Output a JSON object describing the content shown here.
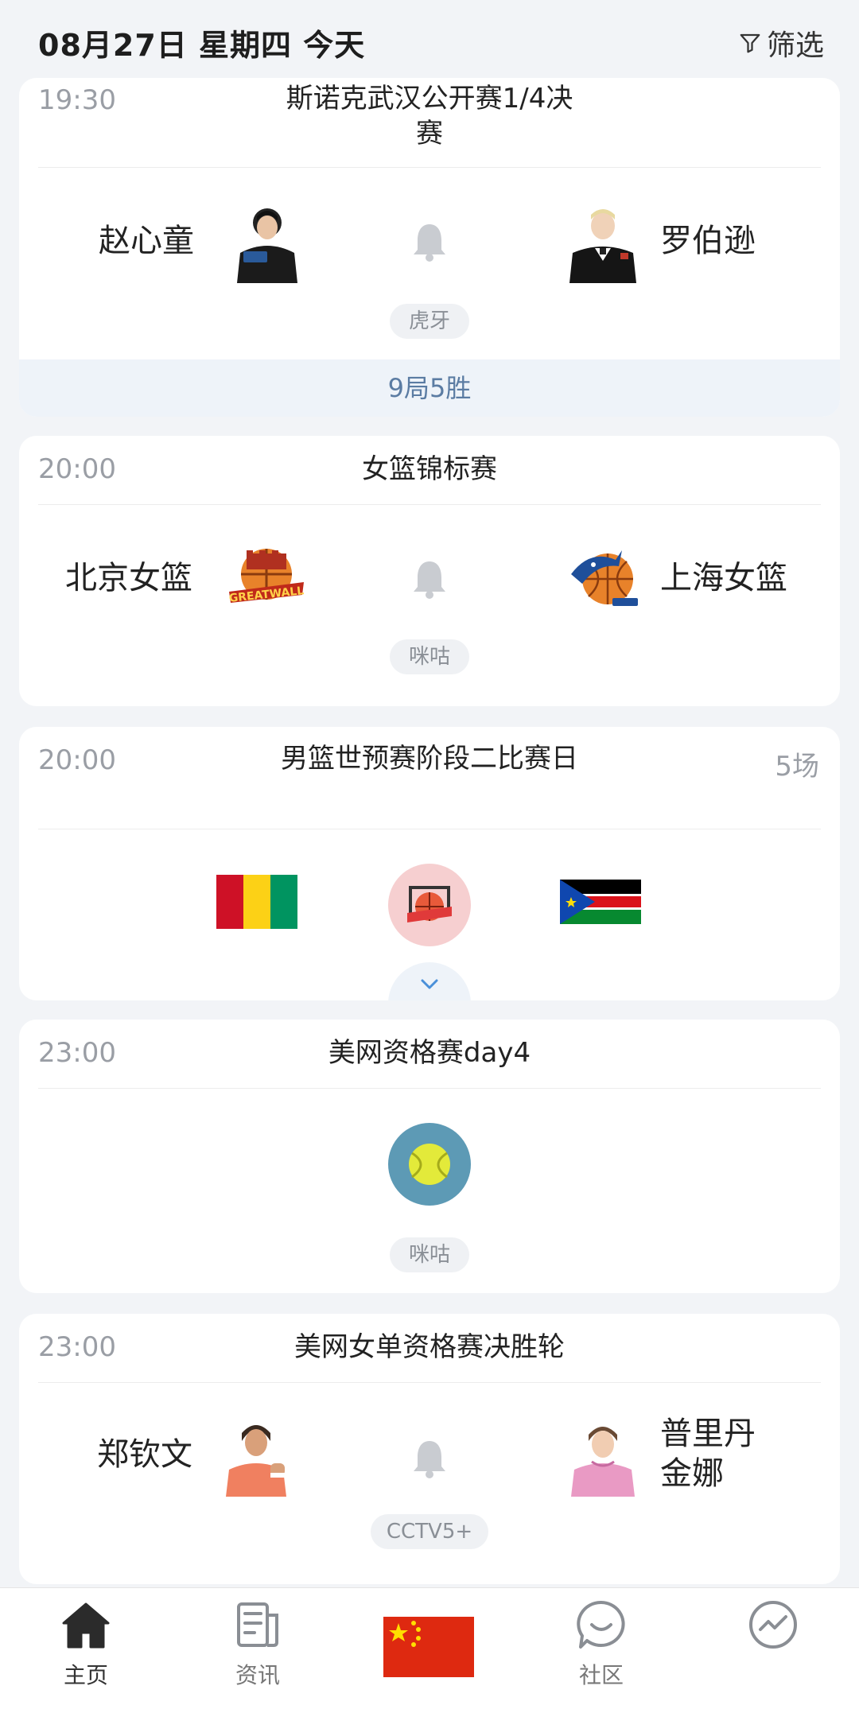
{
  "header": {
    "date": "08月27日 星期四 今天",
    "filter_label": "筛选"
  },
  "matches": [
    {
      "time": "19:30",
      "competition": "斯诺克武汉公开赛1/4决赛",
      "home": "赵心童",
      "away": "罗伯逊",
      "broadcaster": "虎牙",
      "format": "9局5胜"
    },
    {
      "time": "20:00",
      "competition": "女篮锦标赛",
      "home": "北京女篮",
      "away": "上海女篮",
      "broadcaster": "咪咕"
    },
    {
      "time": "20:00",
      "competition": "男篮世预赛阶段二比赛日",
      "count": "5场"
    },
    {
      "time": "23:00",
      "competition": "美网资格赛day4",
      "broadcaster": "咪咕"
    },
    {
      "time": "23:00",
      "competition": "美网女单资格赛决胜轮",
      "home": "郑钦文",
      "away": "普里丹金娜",
      "broadcaster": "CCTV5+"
    }
  ],
  "tabbar": {
    "home": "主页",
    "news": "资讯",
    "community": "社区"
  },
  "colors": {
    "accent_blue": "#5b7ca3",
    "flag_red": "#de2910",
    "flag_yellow": "#ffde00"
  },
  "icons": [
    "filter-icon",
    "bell-icon",
    "basketball-icon",
    "tennis-ball-icon",
    "chevron-down-icon",
    "home-icon",
    "news-icon",
    "chat-icon",
    "trend-icon",
    "china-flag-icon",
    "guinea-flag-icon",
    "south-sudan-flag-icon"
  ]
}
